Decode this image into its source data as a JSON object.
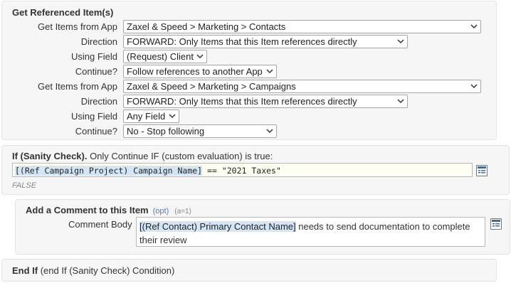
{
  "get_referenced": {
    "title": "Get Referenced Item(s)",
    "rows": [
      {
        "label": "Get Items from App",
        "value": "Zaxel & Speed > Marketing > Contacts"
      },
      {
        "label": "Direction",
        "value": "FORWARD: Only Items that this Item references directly"
      },
      {
        "label": "Using Field",
        "value": "(Request) Client"
      },
      {
        "label": "Continue?",
        "value": "Follow references to another App"
      },
      {
        "label": "Get Items from App",
        "value": "Zaxel & Speed > Marketing > Campaigns"
      },
      {
        "label": "Direction",
        "value": "FORWARD: Only Items that this Item references directly"
      },
      {
        "label": "Using Field",
        "value": "Any Field"
      },
      {
        "label": "Continue?",
        "value": "No - Stop following"
      }
    ]
  },
  "sanity_check": {
    "title_bold": "If (Sanity Check).",
    "title_rest": " Only Continue IF (custom evaluation) is true:",
    "expr_token": "[(Ref Campaign Project) Campaign Name]",
    "expr_rest": " == \"2021 Taxes\"",
    "result": "FALSE"
  },
  "add_comment": {
    "title": "Add a Comment to this Item",
    "opt": "(opt)",
    "count": "(a=1)",
    "body_label": "Comment Body",
    "body_token": "[(Ref Contact) Primary Contact Name]",
    "body_rest": " needs to send documentation to complete their review"
  },
  "end_if": {
    "title_bold": "End If",
    "title_rest": " (end If (Sanity Check) Condition)"
  },
  "icons": {
    "select_arrow": "chevron-down-icon",
    "editor_button": "expression-editor-icon"
  },
  "colors": {
    "panel_bg": "#f6f6f6",
    "token_bg": "#d4e6f6",
    "opt_link": "#4a7db8"
  }
}
